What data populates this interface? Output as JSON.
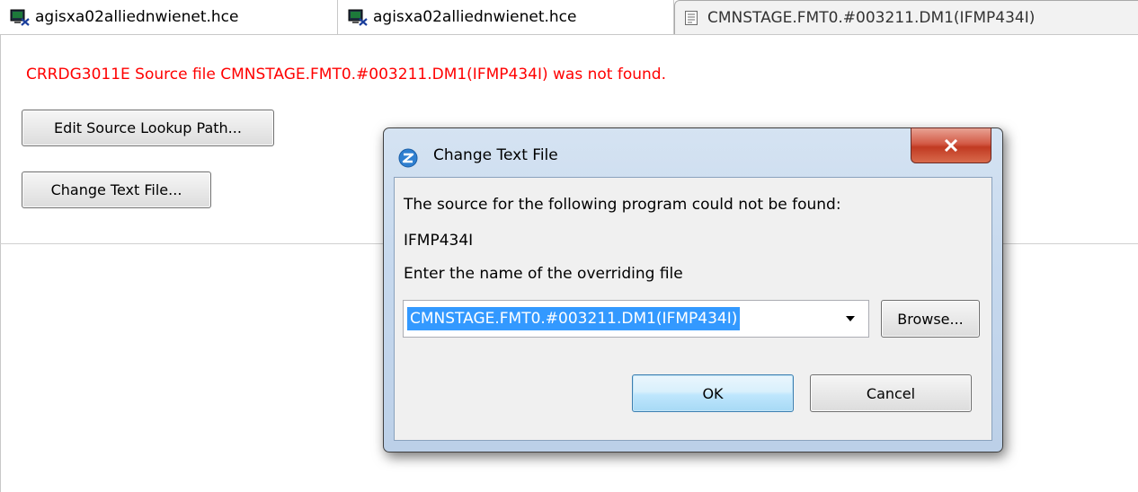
{
  "tabs": [
    {
      "label": "agisxa02alliednwienet.hce",
      "icon": "terminal-session-icon"
    },
    {
      "label": "agisxa02alliednwienet.hce",
      "icon": "terminal-session-icon"
    },
    {
      "label": "CMNSTAGE.FMT0.#003211.DM1(IFMP434I)",
      "icon": "document-icon"
    }
  ],
  "editor": {
    "error_message": "CRRDG3011E Source file CMNSTAGE.FMT0.#003211.DM1(IFMP434I) was not found.",
    "edit_lookup_button": "Edit Source Lookup Path...",
    "change_text_button": "Change Text File..."
  },
  "dialog": {
    "title": "Change Text File",
    "message": "The source for the following program could not be found:",
    "program_name": "IFMP434I",
    "prompt": "Enter the name of the overriding file",
    "file_value": "CMNSTAGE.FMT0.#003211.DM1(IFMP434I)",
    "browse_label": "Browse...",
    "ok_label": "OK",
    "cancel_label": "Cancel"
  },
  "colors": {
    "error_text": "#ff0000",
    "selection": "#3399ff",
    "close_button": "#c9452f"
  }
}
